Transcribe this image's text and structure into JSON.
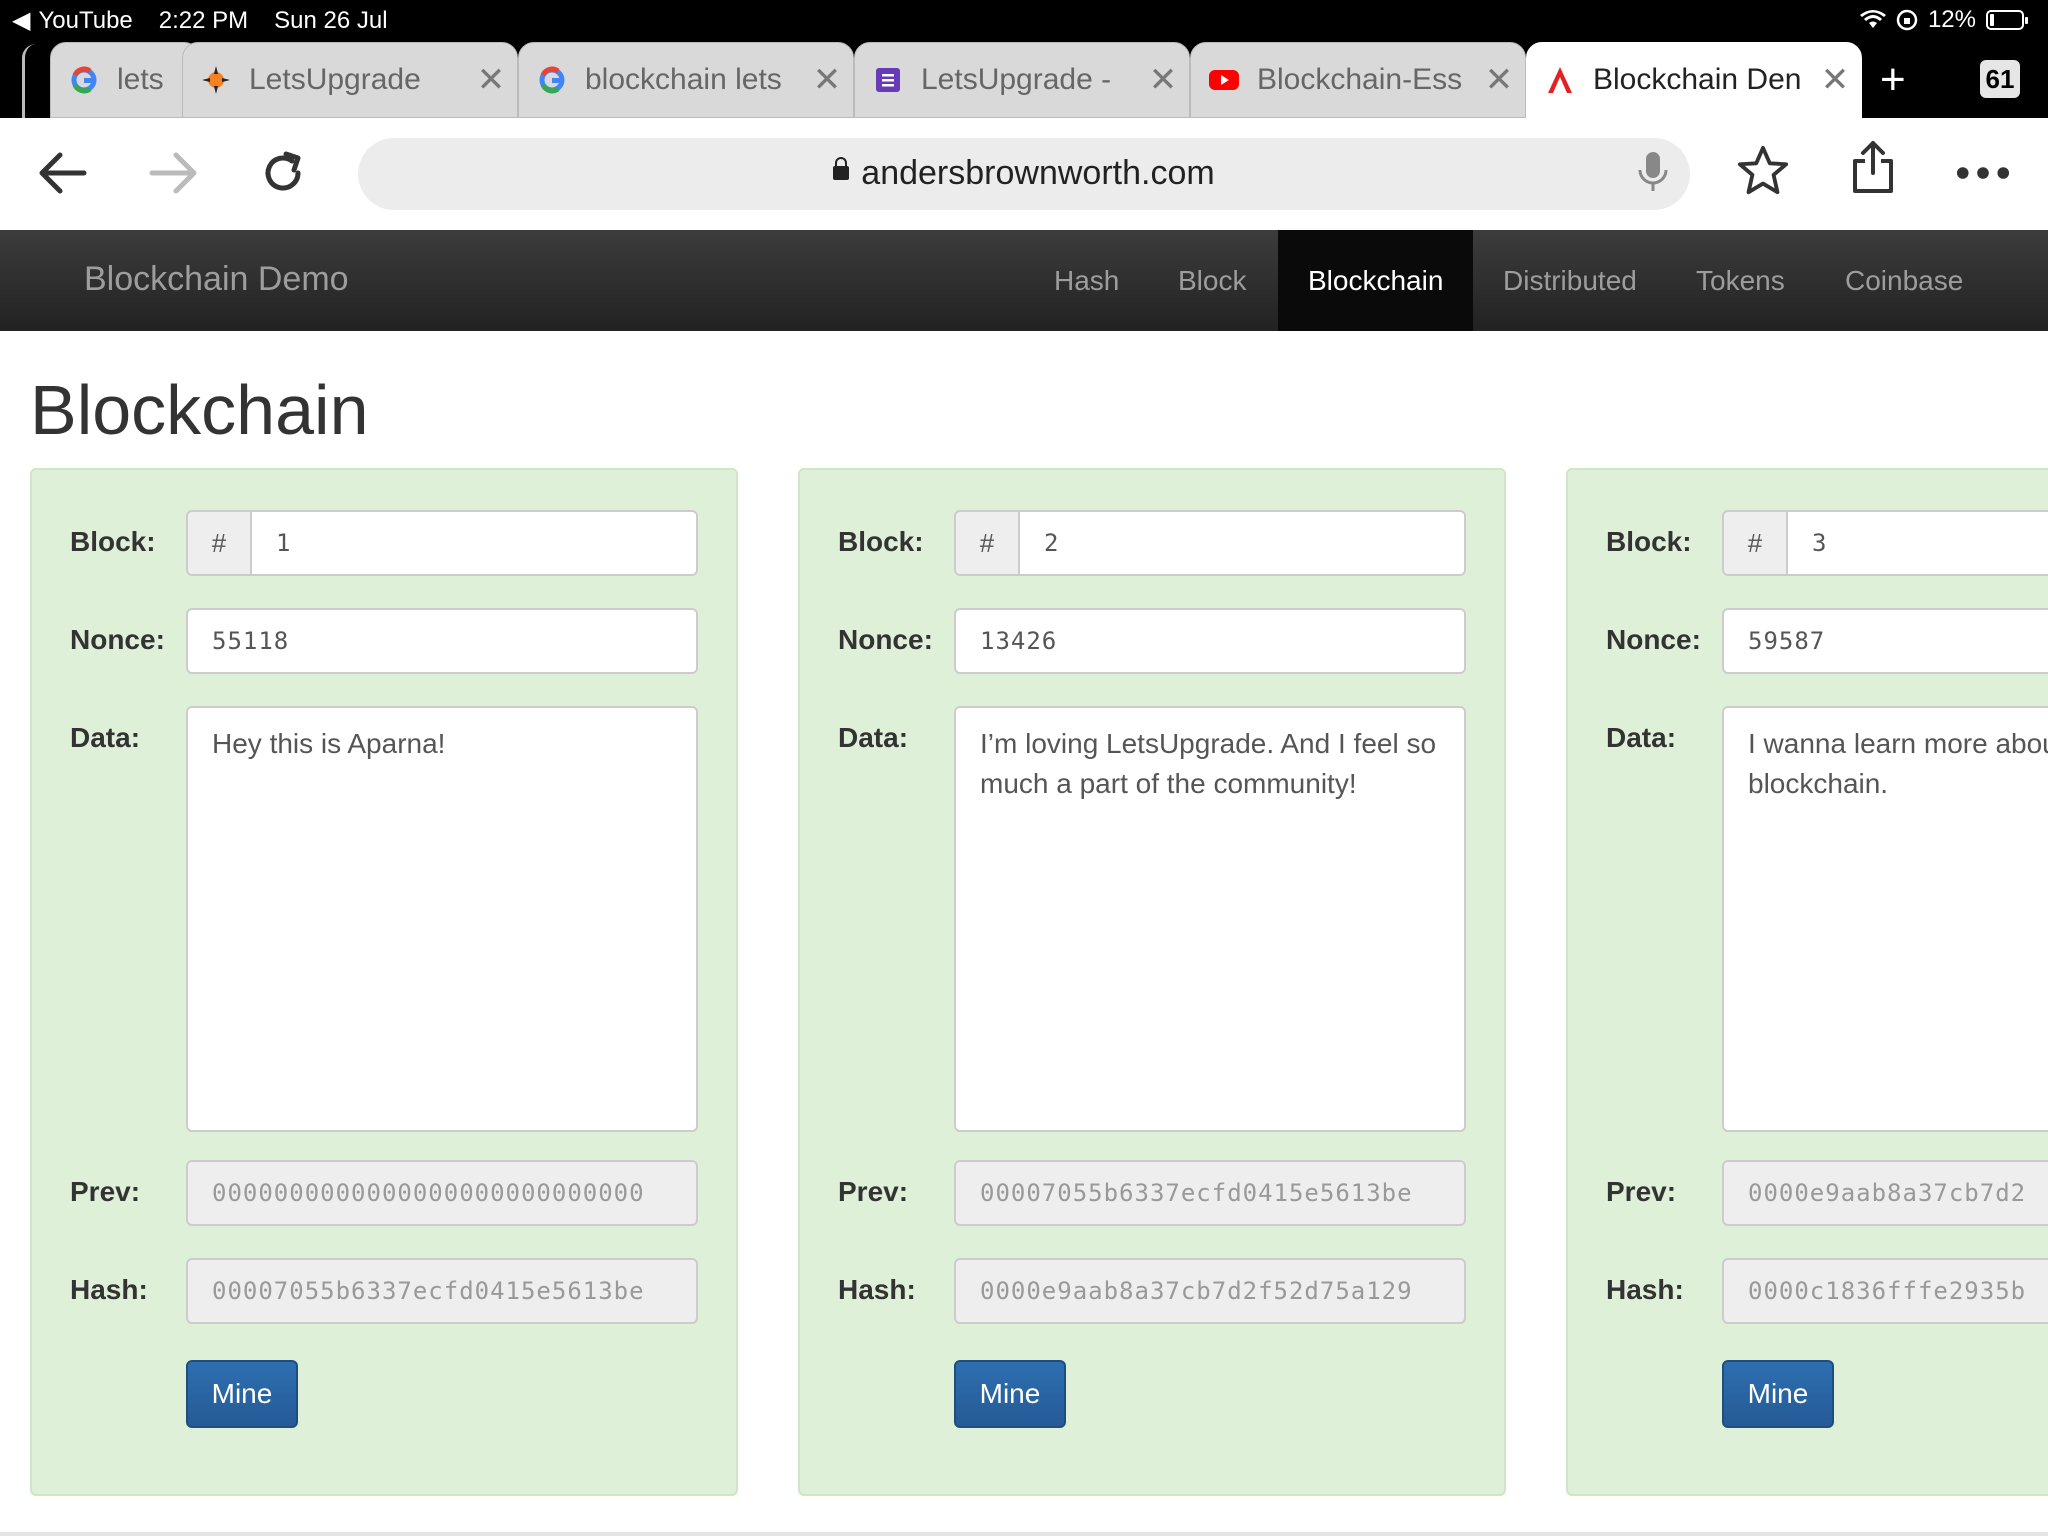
{
  "status_bar": {
    "back_app": "YouTube",
    "time": "2:22 PM",
    "date": "Sun 26 Jul",
    "battery": "12%"
  },
  "tabs": [
    {
      "title": "lets",
      "favicon": "google-icon"
    },
    {
      "title": "LetsUpgrade",
      "favicon": "letsupgrade-icon"
    },
    {
      "title": "blockchain lets",
      "favicon": "google-icon"
    },
    {
      "title": "LetsUpgrade - ",
      "favicon": "forms-icon"
    },
    {
      "title": "Blockchain-Ess",
      "favicon": "youtube-icon"
    },
    {
      "title": "Blockchain Den",
      "favicon": "anders-icon",
      "active": true
    }
  ],
  "tab_count": "61",
  "url": "andersbrownworth.com",
  "navbar": {
    "brand": "Blockchain Demo",
    "items": [
      "Hash",
      "Block",
      "Blockchain",
      "Distributed",
      "Tokens",
      "Coinbase"
    ],
    "active": "Blockchain"
  },
  "page_title": "Blockchain",
  "labels": {
    "block": "Block:",
    "nonce": "Nonce:",
    "data": "Data:",
    "prev": "Prev:",
    "hash": "Hash:",
    "hash_sign": "#",
    "mine": "Mine"
  },
  "blocks": [
    {
      "number": "1",
      "nonce": "55118",
      "data": "Hey this is Aparna!",
      "prev": "0000000000000000000000000000",
      "hash": "00007055b6337ecfd0415e5613be"
    },
    {
      "number": "2",
      "nonce": "13426",
      "data": "I’m loving LetsUpgrade. And I feel so much a part of the community!",
      "prev": "00007055b6337ecfd0415e5613be",
      "hash": "0000e9aab8a37cb7d2f52d75a129"
    },
    {
      "number": "3",
      "nonce": "59587",
      "data": "I wanna learn more about blockchain.",
      "prev": "0000e9aab8a37cb7d2",
      "hash": "0000c1836fffe2935b"
    }
  ],
  "colors": {
    "card_bg": "#dff0d8",
    "navbar_bg": "#222222",
    "button_blue": "#286090"
  }
}
